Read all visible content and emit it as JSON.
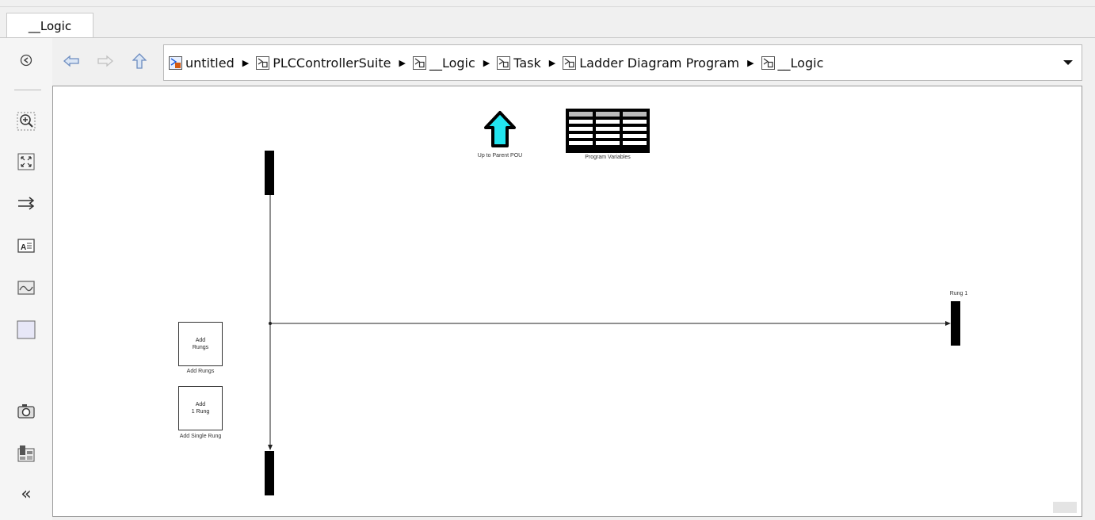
{
  "tab": {
    "label": "__Logic"
  },
  "nav": {
    "back_icon": "back-arrow-icon",
    "forward_icon": "forward-arrow-icon",
    "up_icon": "up-arrow-icon"
  },
  "breadcrumb": {
    "items": [
      {
        "label": "untitled",
        "icon": "model-icon"
      },
      {
        "label": "PLCControllerSuite",
        "icon": "subsystem-icon"
      },
      {
        "label": "__Logic",
        "icon": "subsystem-icon"
      },
      {
        "label": "Task",
        "icon": "subsystem-icon"
      },
      {
        "label": "Ladder Diagram Program",
        "icon": "subsystem-icon"
      },
      {
        "label": "__Logic",
        "icon": "subsystem-icon"
      }
    ]
  },
  "toolbar": {
    "items": [
      "hide-explorer-icon",
      "zoom-icon",
      "fit-to-view-icon",
      "route-lines-icon",
      "annotation-icon",
      "image-icon",
      "area-icon",
      "screenshot-icon",
      "property-inspector-icon",
      "collapse-icon"
    ]
  },
  "canvas": {
    "up_to_parent_label": "Up to Parent POU",
    "program_variables_label": "Program Variables",
    "rung_label": "Rung 1",
    "add_rungs": {
      "text_line1": "Add",
      "text_line2": "Rungs",
      "caption": "Add Rungs"
    },
    "add_single_rung": {
      "text_line1": "Add",
      "text_line2": "1 Rung",
      "caption": "Add Single Rung"
    }
  },
  "colors": {
    "up_arrow_fill": "#22e4ef",
    "rail": "#000000",
    "canvas_bg": "#ffffff"
  }
}
